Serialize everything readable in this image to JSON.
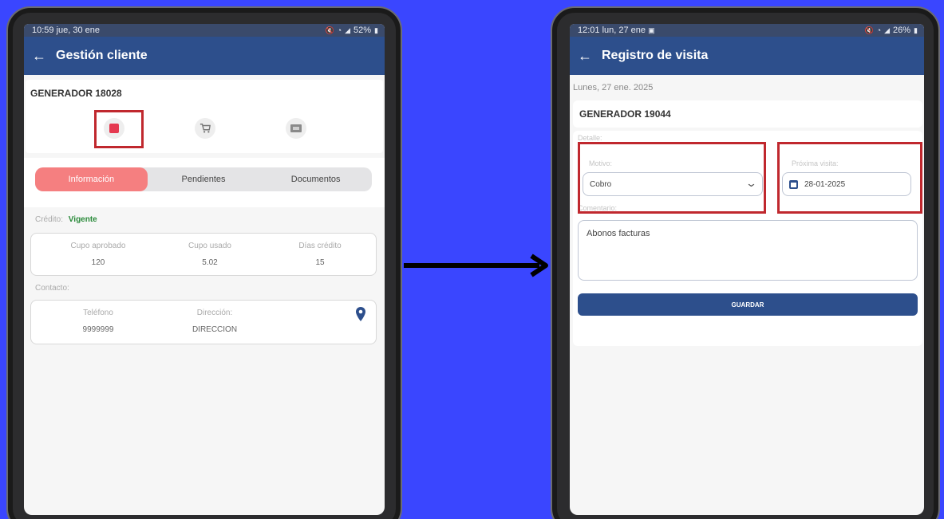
{
  "left_screen": {
    "status": {
      "time_date": "10:59  jue, 30 ene",
      "battery": "52%"
    },
    "appbar": {
      "title": "Gestión cliente"
    },
    "client": {
      "name": "GENERADOR 18028"
    },
    "tabs": [
      {
        "label": "Información",
        "active": true
      },
      {
        "label": "Pendientes",
        "active": false
      },
      {
        "label": "Documentos",
        "active": false
      }
    ],
    "credit": {
      "label": "Crédito:",
      "value": "Vigente"
    },
    "credit_stats": [
      {
        "label": "Cupo aprobado",
        "value": "120"
      },
      {
        "label": "Cupo usado",
        "value": "5.02"
      },
      {
        "label": "Días crédito",
        "value": "15"
      }
    ],
    "contact": {
      "section_label": "Contacto:",
      "phone_label": "Teléfono",
      "phone_value": "9999999",
      "address_label": "Dirección:",
      "address_value": "DIRECCION"
    }
  },
  "right_screen": {
    "status": {
      "time_date": "12:01  lun, 27 ene",
      "battery": "26%"
    },
    "appbar": {
      "title": "Registro de visita"
    },
    "date": "Lunes, 27 ene. 2025",
    "client": {
      "name": "GENERADOR 19044"
    },
    "form": {
      "detail_label": "Detalle:",
      "motive_label": "Motivo:",
      "motive_value": "Cobro",
      "next_visit_label": "Próxima visita:",
      "next_visit_value": "28-01-2025",
      "comment_label": "Comentario:",
      "comment_value": "Abonos facturas",
      "save_label": "GUARDAR"
    }
  },
  "colors": {
    "background": "#3a46ff",
    "appbar": "#2d4f8c",
    "active_tab": "#f57f80",
    "highlight": "#c0282e",
    "status_green": "#2a8a3a"
  }
}
